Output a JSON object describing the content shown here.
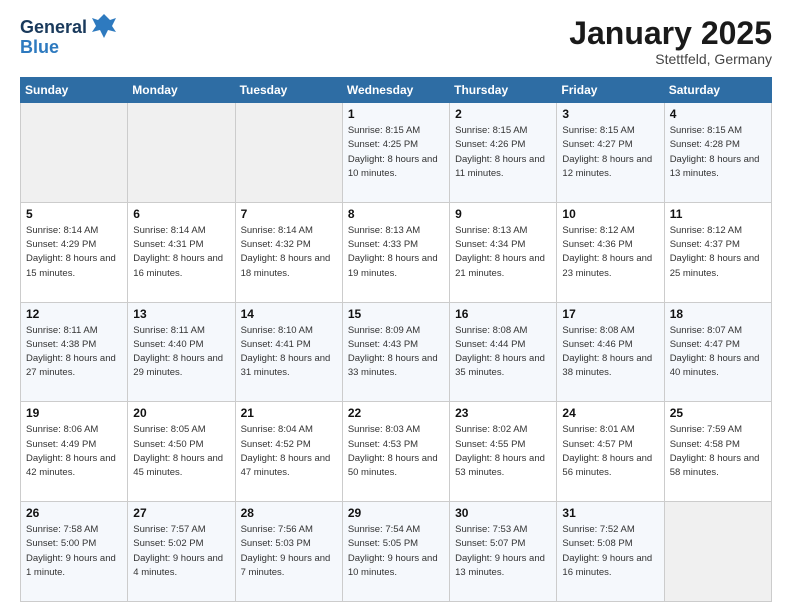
{
  "header": {
    "logo_line1": "General",
    "logo_line2": "Blue",
    "month": "January 2025",
    "location": "Stettfeld, Germany"
  },
  "days_of_week": [
    "Sunday",
    "Monday",
    "Tuesday",
    "Wednesday",
    "Thursday",
    "Friday",
    "Saturday"
  ],
  "weeks": [
    [
      {
        "day": "",
        "sunrise": "",
        "sunset": "",
        "daylight": ""
      },
      {
        "day": "",
        "sunrise": "",
        "sunset": "",
        "daylight": ""
      },
      {
        "day": "",
        "sunrise": "",
        "sunset": "",
        "daylight": ""
      },
      {
        "day": "1",
        "sunrise": "Sunrise: 8:15 AM",
        "sunset": "Sunset: 4:25 PM",
        "daylight": "Daylight: 8 hours and 10 minutes."
      },
      {
        "day": "2",
        "sunrise": "Sunrise: 8:15 AM",
        "sunset": "Sunset: 4:26 PM",
        "daylight": "Daylight: 8 hours and 11 minutes."
      },
      {
        "day": "3",
        "sunrise": "Sunrise: 8:15 AM",
        "sunset": "Sunset: 4:27 PM",
        "daylight": "Daylight: 8 hours and 12 minutes."
      },
      {
        "day": "4",
        "sunrise": "Sunrise: 8:15 AM",
        "sunset": "Sunset: 4:28 PM",
        "daylight": "Daylight: 8 hours and 13 minutes."
      }
    ],
    [
      {
        "day": "5",
        "sunrise": "Sunrise: 8:14 AM",
        "sunset": "Sunset: 4:29 PM",
        "daylight": "Daylight: 8 hours and 15 minutes."
      },
      {
        "day": "6",
        "sunrise": "Sunrise: 8:14 AM",
        "sunset": "Sunset: 4:31 PM",
        "daylight": "Daylight: 8 hours and 16 minutes."
      },
      {
        "day": "7",
        "sunrise": "Sunrise: 8:14 AM",
        "sunset": "Sunset: 4:32 PM",
        "daylight": "Daylight: 8 hours and 18 minutes."
      },
      {
        "day": "8",
        "sunrise": "Sunrise: 8:13 AM",
        "sunset": "Sunset: 4:33 PM",
        "daylight": "Daylight: 8 hours and 19 minutes."
      },
      {
        "day": "9",
        "sunrise": "Sunrise: 8:13 AM",
        "sunset": "Sunset: 4:34 PM",
        "daylight": "Daylight: 8 hours and 21 minutes."
      },
      {
        "day": "10",
        "sunrise": "Sunrise: 8:12 AM",
        "sunset": "Sunset: 4:36 PM",
        "daylight": "Daylight: 8 hours and 23 minutes."
      },
      {
        "day": "11",
        "sunrise": "Sunrise: 8:12 AM",
        "sunset": "Sunset: 4:37 PM",
        "daylight": "Daylight: 8 hours and 25 minutes."
      }
    ],
    [
      {
        "day": "12",
        "sunrise": "Sunrise: 8:11 AM",
        "sunset": "Sunset: 4:38 PM",
        "daylight": "Daylight: 8 hours and 27 minutes."
      },
      {
        "day": "13",
        "sunrise": "Sunrise: 8:11 AM",
        "sunset": "Sunset: 4:40 PM",
        "daylight": "Daylight: 8 hours and 29 minutes."
      },
      {
        "day": "14",
        "sunrise": "Sunrise: 8:10 AM",
        "sunset": "Sunset: 4:41 PM",
        "daylight": "Daylight: 8 hours and 31 minutes."
      },
      {
        "day": "15",
        "sunrise": "Sunrise: 8:09 AM",
        "sunset": "Sunset: 4:43 PM",
        "daylight": "Daylight: 8 hours and 33 minutes."
      },
      {
        "day": "16",
        "sunrise": "Sunrise: 8:08 AM",
        "sunset": "Sunset: 4:44 PM",
        "daylight": "Daylight: 8 hours and 35 minutes."
      },
      {
        "day": "17",
        "sunrise": "Sunrise: 8:08 AM",
        "sunset": "Sunset: 4:46 PM",
        "daylight": "Daylight: 8 hours and 38 minutes."
      },
      {
        "day": "18",
        "sunrise": "Sunrise: 8:07 AM",
        "sunset": "Sunset: 4:47 PM",
        "daylight": "Daylight: 8 hours and 40 minutes."
      }
    ],
    [
      {
        "day": "19",
        "sunrise": "Sunrise: 8:06 AM",
        "sunset": "Sunset: 4:49 PM",
        "daylight": "Daylight: 8 hours and 42 minutes."
      },
      {
        "day": "20",
        "sunrise": "Sunrise: 8:05 AM",
        "sunset": "Sunset: 4:50 PM",
        "daylight": "Daylight: 8 hours and 45 minutes."
      },
      {
        "day": "21",
        "sunrise": "Sunrise: 8:04 AM",
        "sunset": "Sunset: 4:52 PM",
        "daylight": "Daylight: 8 hours and 47 minutes."
      },
      {
        "day": "22",
        "sunrise": "Sunrise: 8:03 AM",
        "sunset": "Sunset: 4:53 PM",
        "daylight": "Daylight: 8 hours and 50 minutes."
      },
      {
        "day": "23",
        "sunrise": "Sunrise: 8:02 AM",
        "sunset": "Sunset: 4:55 PM",
        "daylight": "Daylight: 8 hours and 53 minutes."
      },
      {
        "day": "24",
        "sunrise": "Sunrise: 8:01 AM",
        "sunset": "Sunset: 4:57 PM",
        "daylight": "Daylight: 8 hours and 56 minutes."
      },
      {
        "day": "25",
        "sunrise": "Sunrise: 7:59 AM",
        "sunset": "Sunset: 4:58 PM",
        "daylight": "Daylight: 8 hours and 58 minutes."
      }
    ],
    [
      {
        "day": "26",
        "sunrise": "Sunrise: 7:58 AM",
        "sunset": "Sunset: 5:00 PM",
        "daylight": "Daylight: 9 hours and 1 minute."
      },
      {
        "day": "27",
        "sunrise": "Sunrise: 7:57 AM",
        "sunset": "Sunset: 5:02 PM",
        "daylight": "Daylight: 9 hours and 4 minutes."
      },
      {
        "day": "28",
        "sunrise": "Sunrise: 7:56 AM",
        "sunset": "Sunset: 5:03 PM",
        "daylight": "Daylight: 9 hours and 7 minutes."
      },
      {
        "day": "29",
        "sunrise": "Sunrise: 7:54 AM",
        "sunset": "Sunset: 5:05 PM",
        "daylight": "Daylight: 9 hours and 10 minutes."
      },
      {
        "day": "30",
        "sunrise": "Sunrise: 7:53 AM",
        "sunset": "Sunset: 5:07 PM",
        "daylight": "Daylight: 9 hours and 13 minutes."
      },
      {
        "day": "31",
        "sunrise": "Sunrise: 7:52 AM",
        "sunset": "Sunset: 5:08 PM",
        "daylight": "Daylight: 9 hours and 16 minutes."
      },
      {
        "day": "",
        "sunrise": "",
        "sunset": "",
        "daylight": ""
      }
    ]
  ]
}
